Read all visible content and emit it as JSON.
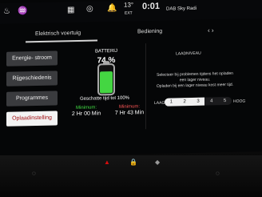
{
  "statusbar": {
    "temperature": "13°",
    "temperature_label": "EXT",
    "time": "0:01",
    "radio": "DAB Sky Radi"
  },
  "tabs": [
    {
      "label": "Elektrisch voertuig"
    },
    {
      "label": "Bediening"
    }
  ],
  "sidebar": [
    {
      "label": "Energie- stroom"
    },
    {
      "label": "Rijgeschiedenis"
    },
    {
      "label": "Programmes"
    },
    {
      "label": "Oplaadinstelling"
    }
  ],
  "battery": {
    "title": "BATTERIJ",
    "percent_text": "74 %",
    "fill_fraction": 0.74,
    "charge_target": "Geschatte tijd tot 100%",
    "min_left_label": "Minimum:",
    "min_left_value": "2 Hr 00 Min",
    "min_right_label": "Minimum:",
    "min_right_value": "7 Hr 43 Min"
  },
  "right": {
    "title": "LAADNIVEAU",
    "message1": "Selecteer bij problemen tijdens het opladen een lager niveau.",
    "message2": "Opladen bij een lager niveau kost meer tijd.",
    "low": "LAAG",
    "high": "HOOG",
    "steps": [
      "1",
      "2",
      "3",
      "4",
      "5"
    ],
    "selected_step": 3
  },
  "colors": {
    "accent_green": "#44d642",
    "accent_red": "#a10d11"
  }
}
